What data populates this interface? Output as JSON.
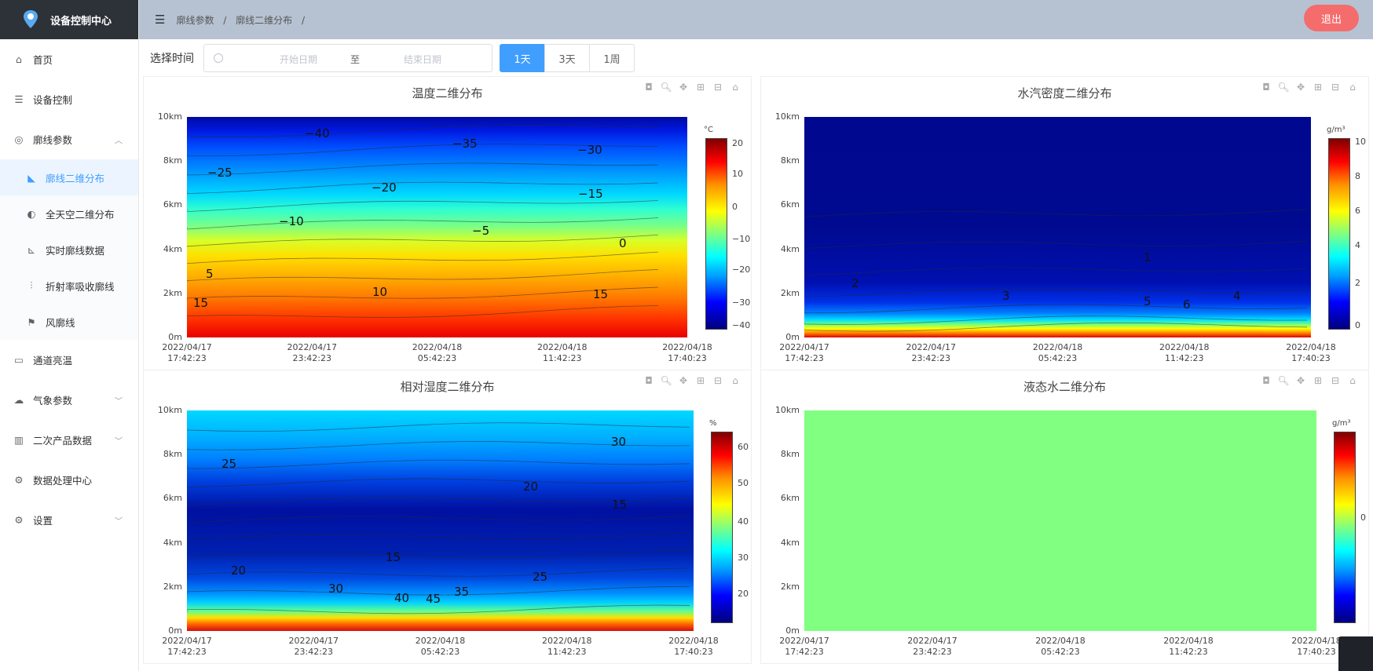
{
  "app": {
    "title": "设备控制中心",
    "logout": "退出"
  },
  "breadcrumb": [
    "廓线参数",
    "廓线二维分布"
  ],
  "sidebar": {
    "items": [
      {
        "label": "首页",
        "icon": "home-icon"
      },
      {
        "label": "设备控制",
        "icon": "sliders-icon"
      },
      {
        "label": "廓线参数",
        "icon": "profile-icon",
        "expanded": true
      },
      {
        "label": "廓线二维分布",
        "icon": "chart-area-icon",
        "sub": true,
        "active": true
      },
      {
        "label": "全天空二维分布",
        "icon": "sky-icon",
        "sub": true
      },
      {
        "label": "实时廓线数据",
        "icon": "line-chart-icon",
        "sub": true
      },
      {
        "label": "折射率吸收廓线",
        "icon": "bars-icon",
        "sub": true
      },
      {
        "label": "风廓线",
        "icon": "flag-icon",
        "sub": true
      },
      {
        "label": "通道亮温",
        "icon": "monitor-icon"
      },
      {
        "label": "气象参数",
        "icon": "cloud-icon",
        "collapsible": true
      },
      {
        "label": "二次产品数据",
        "icon": "bar-icon",
        "collapsible": true
      },
      {
        "label": "数据处理中心",
        "icon": "gear-circle-icon"
      },
      {
        "label": "设置",
        "icon": "settings-icon",
        "collapsible": true
      }
    ]
  },
  "timebar": {
    "label": "选择时间",
    "start_placeholder": "开始日期",
    "separator": "至",
    "end_placeholder": "结束日期",
    "ranges": [
      "1天",
      "3天",
      "1周"
    ],
    "selected": "1天"
  },
  "charts": {
    "y_ticks": [
      "0m",
      "2km",
      "4km",
      "6km",
      "8km",
      "10km"
    ],
    "x_ticks": [
      [
        "2022/04/17",
        "17:42:23"
      ],
      [
        "2022/04/17",
        "23:42:23"
      ],
      [
        "2022/04/18",
        "05:42:23"
      ],
      [
        "2022/04/18",
        "11:42:23"
      ],
      [
        "2022/04/18",
        "17:40:23"
      ]
    ]
  },
  "chart_data": [
    {
      "type": "heatmap",
      "title": "温度二维分布",
      "unit": "°C",
      "colorbar_ticks": [
        "20",
        "10",
        "0",
        "−10",
        "−20",
        "−30",
        "−40"
      ],
      "ylim": [
        0,
        10
      ],
      "contour_labels": [
        "−40",
        "−35",
        "−30",
        "−25",
        "−20",
        "−15",
        "−10",
        "−5",
        "0",
        "5",
        "10",
        "15",
        "15"
      ]
    },
    {
      "type": "heatmap",
      "title": "水汽密度二维分布",
      "unit": "g/m³",
      "colorbar_ticks": [
        "10",
        "8",
        "6",
        "4",
        "2",
        "0"
      ],
      "ylim": [
        0,
        10
      ],
      "contour_labels": [
        "1",
        "2",
        "3",
        "4",
        "5",
        "6"
      ]
    },
    {
      "type": "heatmap",
      "title": "相对湿度二维分布",
      "unit": "%",
      "colorbar_ticks": [
        "60",
        "50",
        "40",
        "30",
        "20"
      ],
      "ylim": [
        0,
        10
      ],
      "contour_labels": [
        "30",
        "25",
        "20",
        "15",
        "15",
        "20",
        "25",
        "30",
        "40",
        "45",
        "35"
      ]
    },
    {
      "type": "heatmap",
      "title": "液态水二维分布",
      "unit": "g/m³",
      "colorbar_ticks": [
        "0"
      ],
      "ylim": [
        0,
        10
      ],
      "contour_labels": []
    }
  ]
}
